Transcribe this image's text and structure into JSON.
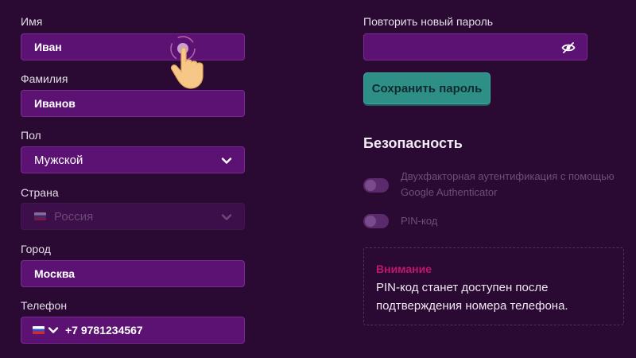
{
  "profile": {
    "first_name": {
      "label": "Имя",
      "value": "Иван"
    },
    "last_name": {
      "label": "Фамилия",
      "value": "Иванов"
    },
    "gender": {
      "label": "Пол",
      "value": "Мужской"
    },
    "country": {
      "label": "Страна",
      "value": "Россия"
    },
    "city": {
      "label": "Город",
      "value": "Москва"
    },
    "phone": {
      "label": "Телефон",
      "value": "+7 9781234567"
    }
  },
  "password": {
    "repeat_label": "Повторить новый пароль",
    "repeat_value": "",
    "save_label": "Сохранить пароль"
  },
  "security": {
    "title": "Безопасность",
    "two_factor_label": "Двухфакторная аутентификация с помощью Google Authenticator",
    "pin_label": "PIN-код",
    "warning_title": "Внимание",
    "warning_text": "PIN-код станет доступен после подтверждения номера телефона."
  },
  "colors": {
    "background": "#2a0a33",
    "field": "#5c1273",
    "accent_button": "#2e8f87",
    "warning": "#c0176a"
  },
  "icons": [
    "chevron-down-icon",
    "flag-ru-icon",
    "eye-off-icon",
    "pointer-hand-icon"
  ]
}
